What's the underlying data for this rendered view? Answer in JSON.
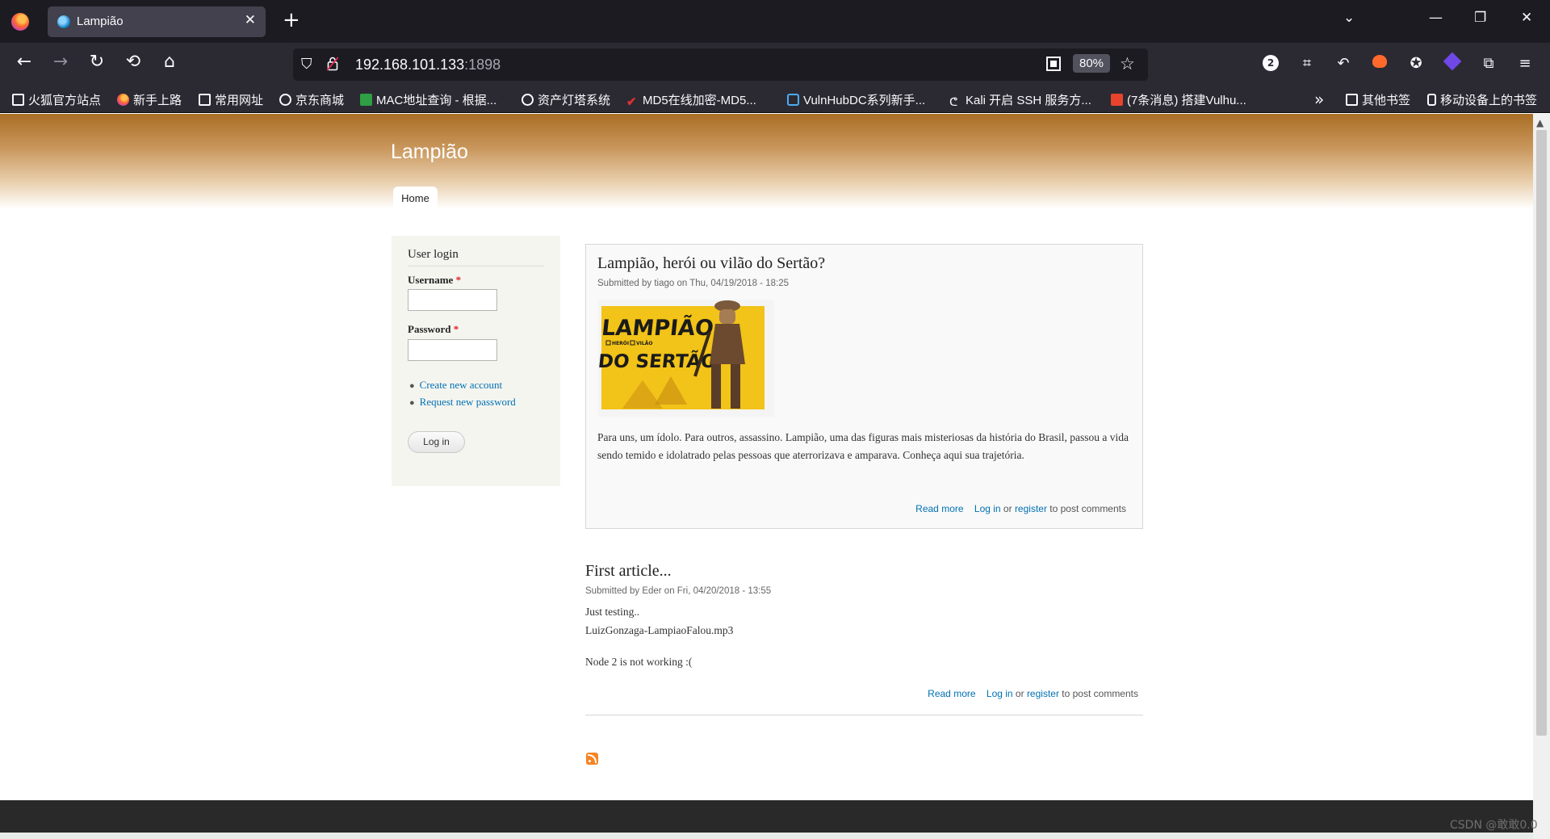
{
  "browser": {
    "tab_title": "Lampião",
    "url_host": "192.168.101.133",
    "url_port": ":1898",
    "zoom": "80%",
    "ext_badge": "2",
    "bookmarks": [
      {
        "label": "火狐官方站点",
        "icon": "folder-icon"
      },
      {
        "label": "新手上路",
        "icon": "firefox-icon"
      },
      {
        "label": "常用网址",
        "icon": "folder-icon"
      },
      {
        "label": "京东商城",
        "icon": "globe-icon"
      },
      {
        "label": "MAC地址查询 - 根据...",
        "icon": "green-icon"
      },
      {
        "label": "资产灯塔系统",
        "icon": "globe-icon"
      },
      {
        "label": "MD5在线加密-MD5...",
        "icon": "check-icon"
      },
      {
        "label": "VulnHubDC系列新手...",
        "icon": "tv-icon"
      },
      {
        "label": "Kali 开启 SSH 服务方...",
        "icon": "kali-icon"
      },
      {
        "label": "(7条消息) 搭建Vulhu...",
        "icon": "csdn-icon"
      },
      {
        "label": "其他书签",
        "icon": "folder-icon"
      },
      {
        "label": "移动设备上的书签",
        "icon": "phone-icon"
      }
    ]
  },
  "site": {
    "name": "Lampião",
    "nav_home": "Home"
  },
  "login": {
    "title": "User login",
    "username_label": "Username",
    "password_label": "Password",
    "required_mark": "*",
    "create_account": "Create new account",
    "request_password": "Request new password",
    "button": "Log in"
  },
  "articles": [
    {
      "title": "Lampião, herói ou vilão do Sertão?",
      "submitted": "Submitted by tiago on Thu, 04/19/2018 - 18:25",
      "image_text": [
        "LAMPIÃO,",
        "HERÓI",
        "VILÃO",
        "DO SERTÃO"
      ],
      "body": "Para uns, um ídolo. Para outros, assassino. Lampião, uma das figuras mais misteriosas da história do Brasil, passou a vida sendo temido e idolatrado pelas pessoas que aterrorizava e amparava. Conheça aqui sua trajetória.",
      "read_more": "Read more",
      "login": "Log in",
      "or": " or ",
      "register": "register",
      "post_comments": " to post comments"
    },
    {
      "title": "First article...",
      "submitted": "Submitted by Eder on Fri, 04/20/2018 - 13:55",
      "body_line1": "Just testing..",
      "body_line2": "LuizGonzaga-LampiaoFalou.mp3",
      "body_line3": "Node 2 is not working :(",
      "read_more": "Read more",
      "login": "Log in",
      "or": " or ",
      "register": "register",
      "post_comments": " to post comments"
    }
  ],
  "watermark": "CSDN @敢敢0.0"
}
